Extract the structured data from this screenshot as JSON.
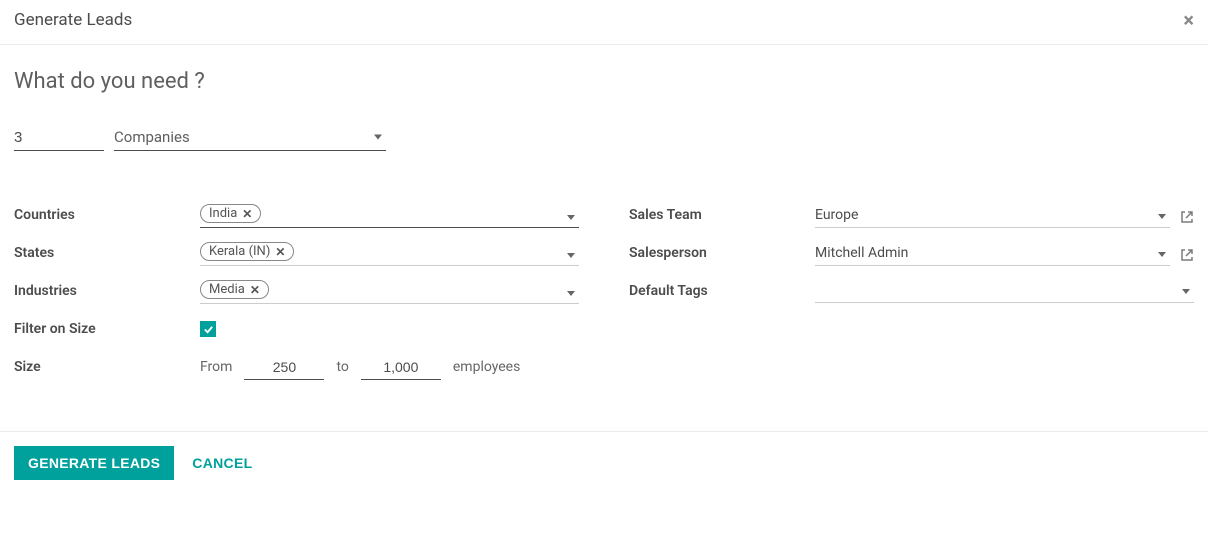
{
  "modal": {
    "title": "Generate Leads",
    "close": "×"
  },
  "section_title": "What do you need ?",
  "count": "3",
  "scope": "Companies",
  "left": {
    "countries_label": "Countries",
    "countries": [
      "India"
    ],
    "states_label": "States",
    "states": [
      "Kerala (IN)"
    ],
    "industries_label": "Industries",
    "industries": [
      "Media"
    ],
    "filter_size_label": "Filter on Size",
    "filter_size_checked": true,
    "size_label": "Size",
    "size_from_label": "From",
    "size_from": "250",
    "size_to_label": "to",
    "size_to": "1,000",
    "size_unit": "employees"
  },
  "right": {
    "sales_team_label": "Sales Team",
    "sales_team": "Europe",
    "salesperson_label": "Salesperson",
    "salesperson": "Mitchell Admin",
    "default_tags_label": "Default Tags",
    "default_tags": ""
  },
  "footer": {
    "generate": "GENERATE LEADS",
    "cancel": "CANCEL"
  }
}
